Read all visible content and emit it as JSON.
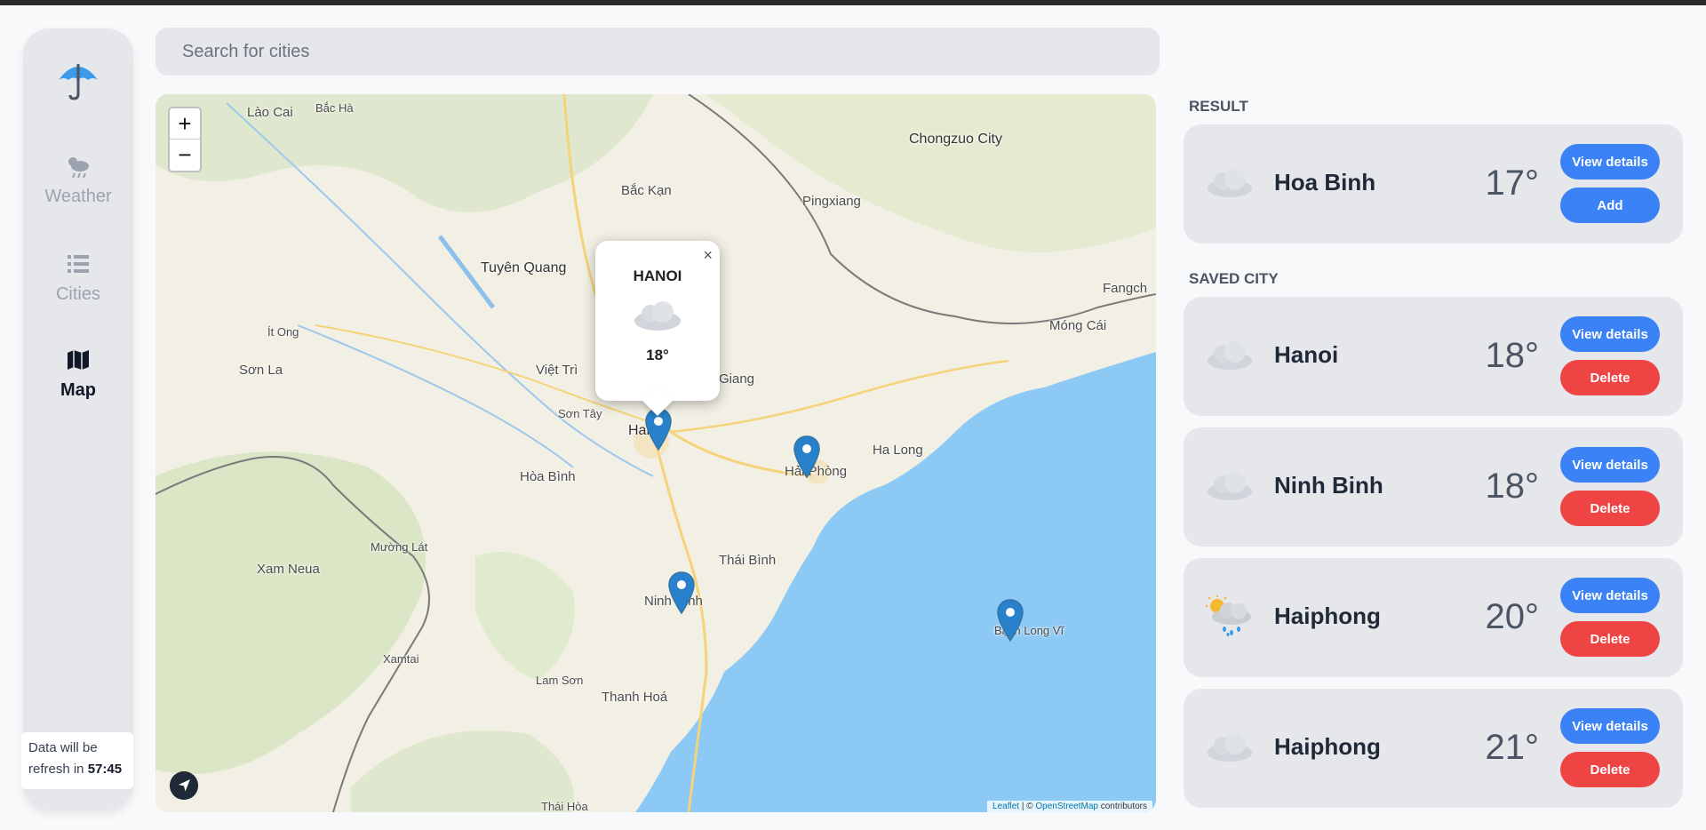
{
  "search": {
    "placeholder": "Search for cities"
  },
  "sidebar": {
    "items": [
      {
        "label": "Weather",
        "icon": "weather-icon",
        "active": false
      },
      {
        "label": "Cities",
        "icon": "list-icon",
        "active": false
      },
      {
        "label": "Map",
        "icon": "map-icon",
        "active": true
      }
    ],
    "refresh": {
      "text": "Data will be refresh in",
      "countdown": "57:45"
    }
  },
  "map": {
    "zoom_in": "+",
    "zoom_out": "−",
    "attribution": {
      "leaflet": "Leaflet",
      "separator": "| ©",
      "osm": "OpenStreetMap",
      "suffix": "contributors"
    },
    "labels": [
      "Lào Cai",
      "Bắc Hà",
      "Chongzuo City",
      "Bắc Kạn",
      "Pingxiang",
      "Tuyên Quang",
      "Fangch",
      "Móng Cái",
      "Ít Ong",
      "Sơn La",
      "Việt Trì",
      "Giang",
      "Sơn Tây",
      "Hanoi",
      "Ha Long",
      "Hải Phòng",
      "Hòa Bình",
      "Mường Lát",
      "Xam Neua",
      "Thái Bình",
      "Ninh Bình",
      "Bạch Long Vĩ",
      "Xamtai",
      "Lam Sơn",
      "Thanh Hoá",
      "Thái Hòa"
    ],
    "popup": {
      "city": "HANOI",
      "temp": "18°",
      "close": "×"
    }
  },
  "result": {
    "title": "RESULT",
    "card": {
      "city": "Hoa Binh",
      "temp": "17°",
      "icon": "cloud-icon",
      "view_label": "View details",
      "action_label": "Add"
    }
  },
  "saved": {
    "title": "SAVED CITY",
    "cards": [
      {
        "city": "Hanoi",
        "temp": "18°",
        "icon": "cloud-icon",
        "view_label": "View details",
        "action_label": "Delete"
      },
      {
        "city": "Ninh Binh",
        "temp": "18°",
        "icon": "cloud-icon",
        "view_label": "View details",
        "action_label": "Delete"
      },
      {
        "city": "Haiphong",
        "temp": "20°",
        "icon": "sun-rain-icon",
        "view_label": "View details",
        "action_label": "Delete"
      },
      {
        "city": "Haiphong",
        "temp": "21°",
        "icon": "cloud-icon",
        "view_label": "View details",
        "action_label": "Delete"
      }
    ]
  },
  "colors": {
    "accent": "#3b82f6",
    "danger": "#ef4444",
    "sea": "#8dc9f5",
    "land": "#f2efe4"
  }
}
